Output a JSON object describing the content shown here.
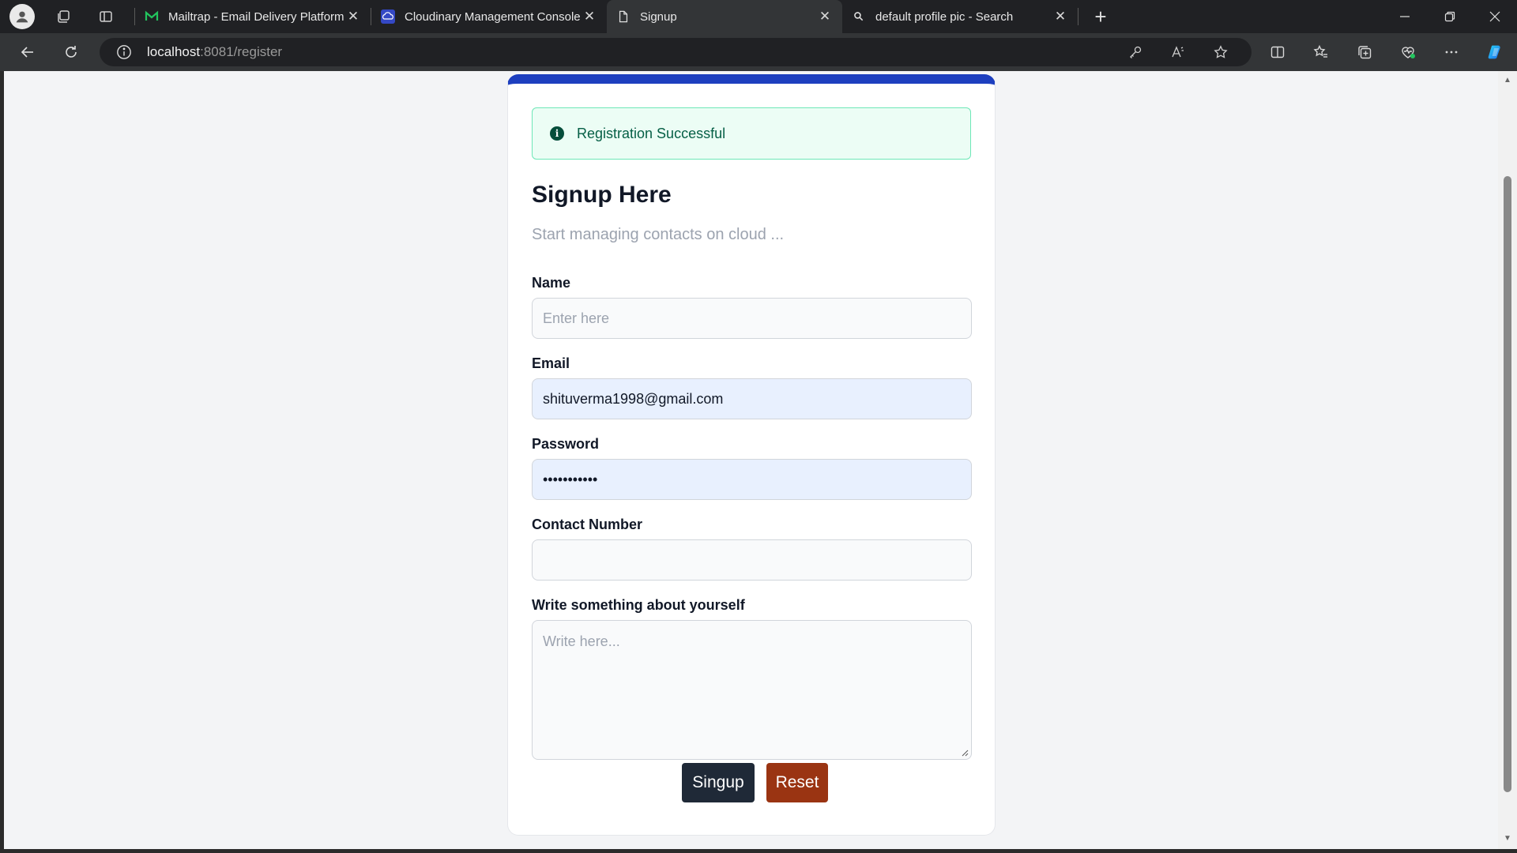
{
  "browser": {
    "tabs": [
      {
        "title": "Mailtrap - Email Delivery Platform",
        "favicon": "mailtrap-icon",
        "active": false
      },
      {
        "title": "Cloudinary Management Console",
        "favicon": "cloudinary-icon",
        "active": false
      },
      {
        "title": "Signup",
        "favicon": "page-icon",
        "active": true
      },
      {
        "title": "default profile pic - Search",
        "favicon": "search-icon",
        "active": false
      }
    ],
    "url_host": "localhost",
    "url_path": ":8081/register"
  },
  "alert": {
    "message": "Registration Successful",
    "icon": "info-icon"
  },
  "form": {
    "heading": "Signup Here",
    "subheading": "Start managing contacts on cloud ...",
    "name": {
      "label": "Name",
      "placeholder": "Enter here",
      "value": ""
    },
    "email": {
      "label": "Email",
      "value": "shituverma1998@gmail.com"
    },
    "password": {
      "label": "Password",
      "masked_value": "•••••••••••"
    },
    "contact": {
      "label": "Contact Number",
      "value": ""
    },
    "about": {
      "label": "Write something about yourself",
      "placeholder": "Write here..."
    },
    "submit_label": "Singup",
    "reset_label": "Reset"
  },
  "colors": {
    "card_top_border": "#1d3fbf",
    "submit_button": "#1f2937",
    "reset_button": "#9a3412",
    "alert_background": "#ecfdf5",
    "alert_text": "#065f46"
  }
}
